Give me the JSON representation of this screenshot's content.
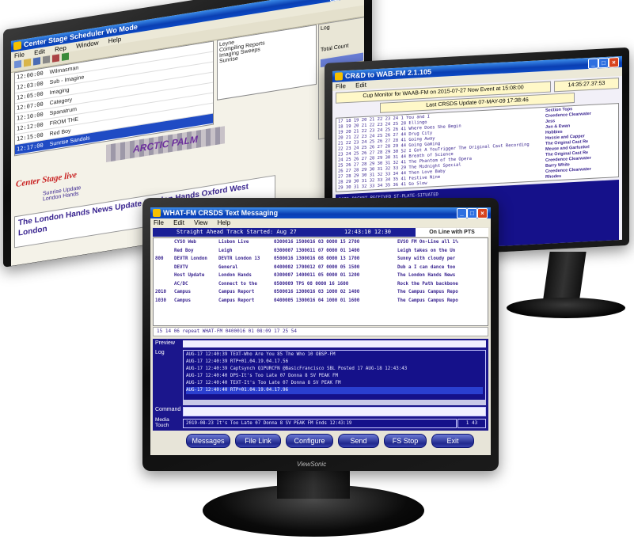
{
  "monitor_back_left": {
    "title": "Center Stage Scheduler Wo Mode",
    "menu": [
      "File",
      "Edit",
      "Rep",
      "Window",
      "Help"
    ],
    "grid_rows": [
      {
        "time": "12:00:00",
        "title": "Wilmasman"
      },
      {
        "time": "12:03:00",
        "title": "Sub - Imagine"
      },
      {
        "time": "12:05:00",
        "title": "Imaging"
      },
      {
        "time": "12:07:00",
        "title": "Category"
      },
      {
        "time": "12:10:00",
        "title": "Spanatrum"
      },
      {
        "time": "12:12:00",
        "title": "FROM THE"
      },
      {
        "time": "12:15:00",
        "title": "Red Boy"
      },
      {
        "time": "12:17:00",
        "title": "Sunrise Sandals"
      }
    ],
    "right_col": [
      "Leyne",
      "Compiling Reports",
      "Imaging Sweeps",
      "Sunrise"
    ],
    "banner_text": "ARCTIC PALM",
    "logo_text": "Center Stage live",
    "sub_labels": [
      "Sunrise Update",
      "London Hands"
    ],
    "ticker": "The London Hands News Update  London Hands Oxford West London",
    "side_panel": [
      "Log",
      "Total Count"
    ]
  },
  "monitor_back_right": {
    "title": "CR&D to WAB-FM 2.1.105",
    "menu": [
      "File",
      "Edit"
    ],
    "header_bar": "Cup Monitor for WAAB-FM on 2015-07-27  Now Event at 15:08:00",
    "clock": "14:35:27.37:53",
    "sub_header": "Last CRSDS Update 07-MAY-09 17:38:46",
    "log_lines": [
      "17 18 19 20 21 22 23 24 1 You and I",
      "18 19 20 21 22 23 24 25 28 Ellingo",
      "19 20 21 22 23 24 25 26 41 Where Does She Begin",
      "20 21 22 23 24 25 26 27 44 Drug City",
      "21 22 23 24 25 26 27 28 41 Going Away",
      "22 23 24 25 26 27 28 29 44 Going Gaming",
      "23 24 25 26 27 28 29 30 52 I Got A YouTrigger  The Original Cast Recording",
      "24 25 26 27 28 29 30 31 44 Breath of Science",
      "25 26 27 28 29 30 31 32 41 The Phantom of the Opera",
      "26 27 28 29 30 31 32 33 29 The Midnight Special",
      "27 28 29 30 31 32 33 34 44 Then Love Baby",
      "28 29 30 31 32 33 34 35 41 Festive Nine",
      "29 30 31 32 33 34 35 36 41 Go Slow"
    ],
    "artists": [
      "Section Tops",
      "Creedence Clearwater",
      "Jess",
      "Jon & Ewan",
      "Hobbies",
      "Hossie and Capper",
      "The Original Cast Re",
      "Meuse and Garfunkel",
      "The Original Cast Re",
      "Creedence Clearwater",
      "Barry White",
      "Creedence Clearwater",
      "Rhodes"
    ],
    "lower_lines": [
      "DATA PACKET RECEIVED ST-PLATE-SITUATED",
      "CASE REQUEST NONE",
      "SAME ENTRY UPDATE TRANS FORMATTING",
      "= CASE SELECTED, CASE PRESENT, 15 PINS",
      "UPLINK DATA RETURNED",
      "DONE WITH ENTRY LOGS",
      "PATH RESOLVED"
    ]
  },
  "monitor_front": {
    "title": "WHAT-FM CRSDS Text Messaging",
    "menu": [
      "File",
      "Edit",
      "View",
      "Help"
    ],
    "status_left": "Straight Ahead Track Started: Aug 27",
    "status_clock": "12:43:10 12:30",
    "status_right": "On Line with PTS",
    "rows": [
      {
        "c1": "",
        "c2": "CYSO Web",
        "c3": "Lisbon Live",
        "c4": "0300016 1500016 03 0000 15 2700",
        "c5": "EVSO FM On-Line all 1%"
      },
      {
        "c1": "",
        "c2": "Red Boy",
        "c3": "Leigh",
        "c4": "0300007 1300011 07 0000 01 1400",
        "c5": "Leigh takes on the Un"
      },
      {
        "c1": "800",
        "c2": "DEVTR London",
        "c3": "DEVTR London 13",
        "c4": "0500016 1300016 08 0000 13 1700",
        "c5": "Sunny with cloudy per"
      },
      {
        "c1": "",
        "c2": "",
        "c3": "",
        "c4": "",
        "c5": ""
      },
      {
        "c1": "",
        "c2": "DEVTV",
        "c3": "General",
        "c4": "0400002 1700012 07 0000 05 1500",
        "c5": "Dub a I can dance too"
      },
      {
        "c1": "",
        "c2": "Host Update",
        "c3": "London Hands",
        "c4": "0300007 1400011 05 0000 01 1200",
        "c5": "The London Hands News"
      },
      {
        "c1": "",
        "c2": "AC/DC",
        "c3": "Connect to the",
        "c4": "0500009 TPS 08 0000 16 1600",
        "c5": "Rock the Path backbone"
      },
      {
        "c1": "",
        "c2": "",
        "c3": "",
        "c4": "",
        "c5": ""
      },
      {
        "c1": "2010",
        "c2": "Campus",
        "c3": "Campus Report",
        "c4": "0500016 1300016 03 1000 02 1400",
        "c5": "The Campus Campus Repo"
      },
      {
        "c1": "1030",
        "c2": "Campus",
        "c3": "Campus Report",
        "c4": "0400005 1300016 04 1000 01 1600",
        "c5": "The Campus Campus Repo"
      }
    ],
    "summary_line": "15 14 06 repeat WHAT-FM  0400016 01 08:09 17 25 54",
    "preview_label": "Preview",
    "log_label": "Log",
    "log_lines": [
      "AUG-17 12:40:39 TEXT-Who Are You 85 The Who 10 OBSP-FM",
      "AUG-17 12:40:39 RTP+01.04.19.04.17.56",
      "AUG-17 12:40:39 Captsynch Q1PURCFN @BasicFrancisco  SBL Posted 17 AUG-18 12:43:43",
      "AUG-17 12:40:40 DPS-It's Too Late 07 Donna 8 SV PEAK FM",
      "AUG-17 12:40:40 TEXT-It's Too Late 07 Donna 8 SV PEAK FM",
      "AUG-17 12:40:40 RTP+01.04.19.04.17.96"
    ],
    "selected_log_index": 5,
    "command_label": "Command",
    "media_label": "Media Touch",
    "media_line": "2019-08-23 It's Too Late 07 Donna 8 SV PEAK FM  Ends 12:43:19",
    "media_counter": "1 43",
    "buttons": [
      "Messages",
      "File Link",
      "Configure",
      "Send",
      "FS Stop",
      "Exit"
    ],
    "brand": "ViewSonic"
  },
  "colors": {
    "xp_blue": "#0a3fb3",
    "log_navy": "#15118a",
    "log_text": "#e8e8ff",
    "selection_blue": "#2a3fd0",
    "text_purple": "#3a2590",
    "window_gray": "#ece9d8"
  }
}
